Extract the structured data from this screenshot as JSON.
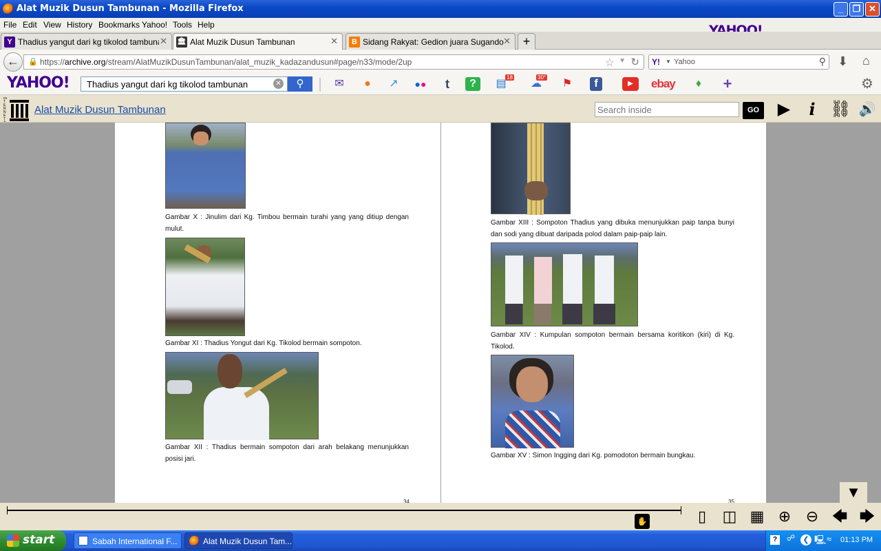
{
  "window": {
    "title": "Alat Muzik Dusun Tambunan - Mozilla Firefox",
    "btn_min": "_",
    "btn_max": "❐",
    "btn_close": "✕"
  },
  "menu": [
    "File",
    "Edit",
    "View",
    "History",
    "Bookmarks",
    "Yahoo!",
    "Tools",
    "Help"
  ],
  "yahoo_brand": "YAHOO!",
  "tabs": [
    {
      "label": "Thadius yangut dari kg tikolod tambunan ...",
      "favicon": "Y",
      "color": "#400090"
    },
    {
      "label": "Alat Muzik Dusun Tambunan",
      "favicon": "🏛",
      "color": "#333333"
    },
    {
      "label": "Sidang Rakyat: Gedion juara Sugandoi K...",
      "favicon": "B",
      "color": "#f57d00"
    }
  ],
  "tab_close": "✕",
  "new_tab": "+",
  "address": {
    "prefix": "https://",
    "domain": "archive.org",
    "path": "/stream/AlatMuzikDusunTambunan/alat_muzik_kadazandusun#page/n33/mode/2up"
  },
  "search_engine": {
    "label": "Y!",
    "placeholder": "Yahoo"
  },
  "yahoo_toolbar": {
    "logo": "YAHOO!",
    "query": "Thadius yangut dari kg tikolod tambunan",
    "badge_news": "18",
    "badge_weather": "30°",
    "ebay": "ebay"
  },
  "archive": {
    "logo_text": "INTERNET ARCHIVE",
    "title": "Alat Muzik Dusun Tambunan",
    "search_placeholder": "Search inside",
    "go": "GO"
  },
  "book": {
    "left": {
      "captions": [
        "Gambar X : Jinulim dari Kg. Timbou bermain turahi yang yang ditiup dengan mulut.",
        "Gambar XI : Thadius Yongut dari Kg. Tikolod bermain sompoton.",
        "Gambar XII : Thadius bermain sompoton dari arah belakang menunjukkan posisi jari."
      ],
      "page_number": "34"
    },
    "right": {
      "captions": [
        "Gambar  XIII : Sompoton Thadius yang dibuka menunjukkan paip tanpa bunyi dan sodi yang dibuat daripada polod dalam paip-paip lain.",
        "Gambar   XIV : Kumpulan sompoton bermain bersama koritikon (kiri) di Kg. Tikolod.",
        "Gambar  XV : Simon Ingging dari Kg. pomodoton bermain bungkau."
      ],
      "page_number": "35"
    }
  },
  "taskbar": {
    "start": "start",
    "tasks": [
      "Sabah International F...",
      "Alat Muzik Dusun Tam..."
    ],
    "clock": "01:13 PM"
  }
}
